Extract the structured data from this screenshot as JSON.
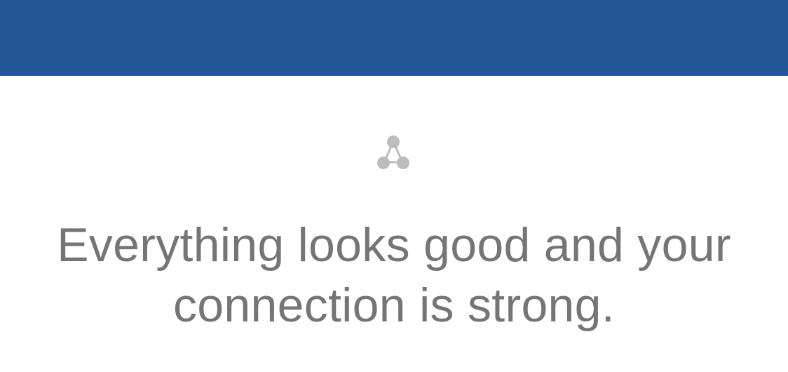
{
  "header": {
    "background_color": "#245596"
  },
  "status": {
    "icon": "network-connection-icon",
    "icon_color": "#BDBDBD",
    "message": "Everything looks good and your connection is strong.",
    "text_color": "#757575"
  }
}
